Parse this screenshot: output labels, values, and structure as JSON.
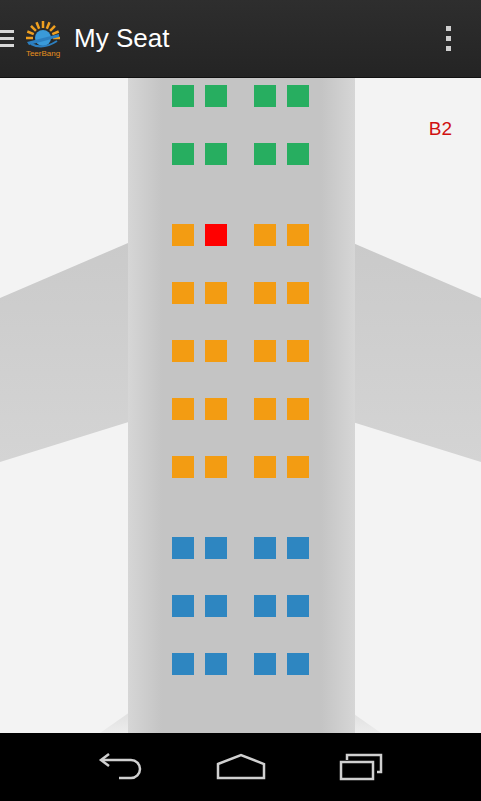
{
  "app_bar": {
    "logo_text": "TeerBang",
    "title": "My Seat"
  },
  "seat_label": "B2",
  "sections": [
    {
      "color": "#27ae60",
      "rows": [
        {
          "seats": [
            {
              "selected": false
            },
            {
              "selected": false
            },
            {
              "selected": false
            },
            {
              "selected": false
            }
          ]
        },
        {
          "seats": [
            {
              "selected": false
            },
            {
              "selected": false
            },
            {
              "selected": false
            },
            {
              "selected": false
            }
          ]
        }
      ]
    },
    {
      "color": "#f39c12",
      "rows": [
        {
          "seats": [
            {
              "selected": false
            },
            {
              "selected": true
            },
            {
              "selected": false
            },
            {
              "selected": false
            }
          ]
        },
        {
          "seats": [
            {
              "selected": false
            },
            {
              "selected": false
            },
            {
              "selected": false
            },
            {
              "selected": false
            }
          ]
        },
        {
          "seats": [
            {
              "selected": false
            },
            {
              "selected": false
            },
            {
              "selected": false
            },
            {
              "selected": false
            }
          ]
        },
        {
          "seats": [
            {
              "selected": false
            },
            {
              "selected": false
            },
            {
              "selected": false
            },
            {
              "selected": false
            }
          ]
        },
        {
          "seats": [
            {
              "selected": false
            },
            {
              "selected": false
            },
            {
              "selected": false
            },
            {
              "selected": false
            }
          ]
        }
      ]
    },
    {
      "color": "#2e86c1",
      "rows": [
        {
          "seats": [
            {
              "selected": false
            },
            {
              "selected": false
            },
            {
              "selected": false
            },
            {
              "selected": false
            }
          ]
        },
        {
          "seats": [
            {
              "selected": false
            },
            {
              "selected": false
            },
            {
              "selected": false
            },
            {
              "selected": false
            }
          ]
        },
        {
          "seats": [
            {
              "selected": false
            },
            {
              "selected": false
            },
            {
              "selected": false
            },
            {
              "selected": false
            }
          ]
        }
      ]
    }
  ]
}
